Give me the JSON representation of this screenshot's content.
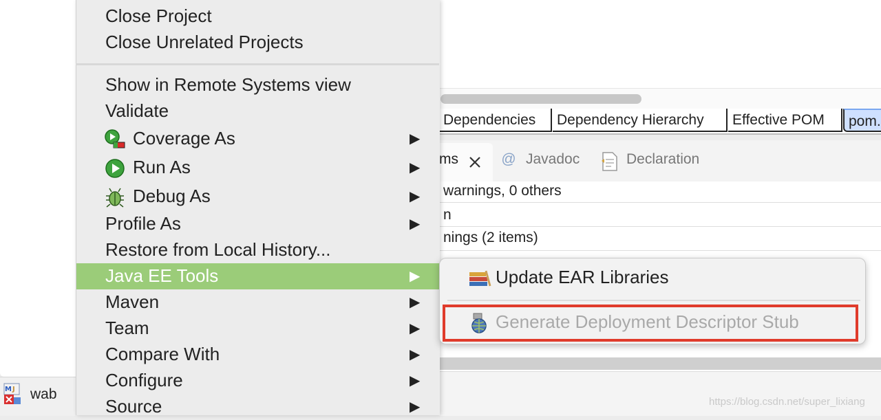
{
  "taskbar": {
    "wab_label": "wab"
  },
  "editor": {
    "tabs": [
      "Dependencies",
      "Dependency Hierarchy",
      "Effective POM",
      "pom."
    ]
  },
  "views": {
    "problems_partial": "ms",
    "javadoc": "Javadoc",
    "declaration": "Declaration",
    "summary_partial": "warnings, 0 others",
    "row1_partial": "n",
    "row2_partial": "nings (2 items)"
  },
  "menu": {
    "items": [
      {
        "label": "Close Project"
      },
      {
        "label": "Close Unrelated Projects"
      },
      {
        "label": "Show in Remote Systems view"
      },
      {
        "label": "Validate"
      },
      {
        "label": "Coverage As",
        "icon": "coverage-icon"
      },
      {
        "label": "Run As",
        "icon": "run-icon"
      },
      {
        "label": "Debug As",
        "icon": "debug-bug-icon"
      },
      {
        "label": "Profile As"
      },
      {
        "label": "Restore from Local History..."
      },
      {
        "label": "Java EE Tools"
      },
      {
        "label": "Maven"
      },
      {
        "label": "Team"
      },
      {
        "label": "Compare With"
      },
      {
        "label": "Configure"
      },
      {
        "label": "Source"
      }
    ],
    "arrow": "▶",
    "highlight_color": "#9bcc79"
  },
  "submenu": {
    "items": [
      {
        "label": "Update EAR Libraries",
        "icon": "library-books-icon"
      },
      {
        "label": "Generate Deployment Descriptor Stub",
        "icon": "globe-gear-icon",
        "disabled": true
      }
    ],
    "highlight_border_color": "#e03b2b"
  },
  "watermark": "https://blog.csdn.net/super_lixiang"
}
